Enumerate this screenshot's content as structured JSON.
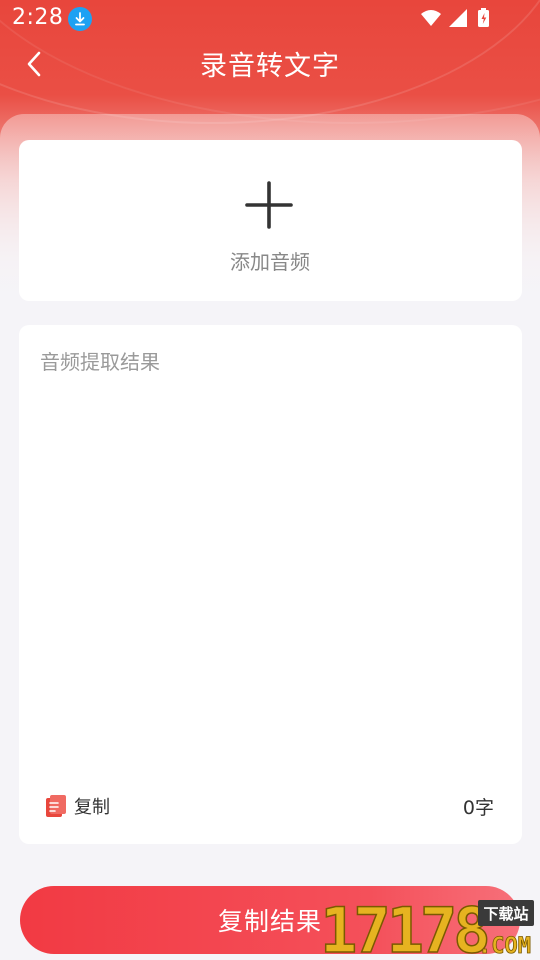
{
  "status_bar": {
    "time": "2:28"
  },
  "header": {
    "title": "录音转文字"
  },
  "add_audio": {
    "label": "添加音频"
  },
  "result": {
    "placeholder": "音频提取结果",
    "value": "",
    "copy_label": "复制",
    "char_count": "0字"
  },
  "footer": {
    "copy_result_label": "复制结果"
  },
  "watermark": {
    "number": "17178",
    "badge": "下载站",
    "suffix": ".COM"
  },
  "colors": {
    "brand_red": "#e8463c",
    "button_red": "#f23a43",
    "download_blue": "#1ea1f3",
    "watermark_gold": "#e6b320"
  },
  "icons": {
    "back": "chevron-left-icon",
    "download": "download-icon",
    "wifi": "wifi-icon",
    "signal": "signal-icon",
    "battery": "battery-icon",
    "add": "plus-icon",
    "copy": "document-icon"
  }
}
